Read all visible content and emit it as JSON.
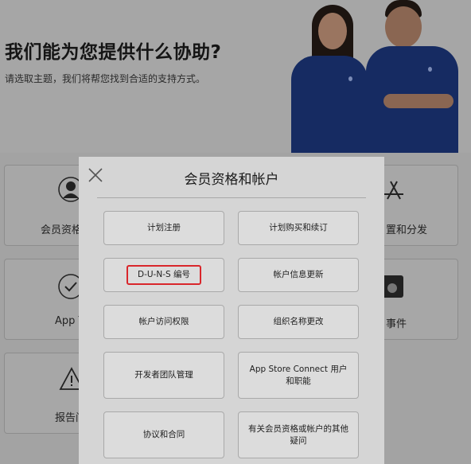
{
  "hero": {
    "title": "我们能为您提供什么协助?",
    "subtitle": "请选取主题，我们将帮您找到合适的支持方式。"
  },
  "tiles": [
    {
      "label": "会员资格",
      "icon": "person-icon"
    },
    {
      "label": "App Tr",
      "icon": "checkmark-circle-icon"
    },
    {
      "label": "报告问",
      "icon": "warning-icon"
    },
    {
      "label": "置和分发",
      "icon": "app-store-icon"
    },
    {
      "label": "事件",
      "icon": "apple-box-icon"
    }
  ],
  "modal": {
    "title": "会员资格和帐户",
    "close_icon": "close-icon",
    "options": [
      "计划注册",
      "计划购买和续订",
      "D-U-N-S 编号",
      "帐户信息更新",
      "帐户访问权限",
      "组织名称更改",
      "开发者团队管理",
      "App Store Connect 用户和职能",
      "协议和合同",
      "有关会员资格或帐户的其他疑问"
    ],
    "highlight_color": "#d9262b"
  }
}
